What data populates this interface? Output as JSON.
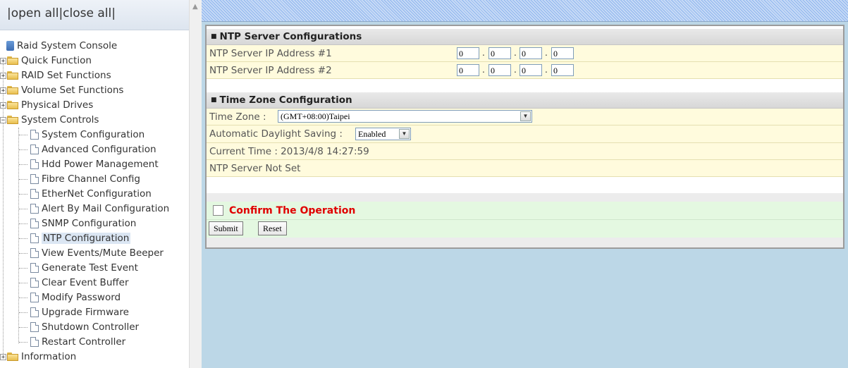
{
  "toolbar": {
    "open_all": "open all",
    "close_all": "close all",
    "separator": "|"
  },
  "tree": {
    "root_label": "Raid System Console",
    "items": [
      {
        "label": "Quick Function"
      },
      {
        "label": "RAID Set Functions"
      },
      {
        "label": "Volume Set Functions"
      },
      {
        "label": "Physical Drives"
      },
      {
        "label": "System Controls"
      },
      {
        "label": "Information"
      }
    ],
    "system_controls_children": [
      {
        "label": "System Configuration"
      },
      {
        "label": "Advanced Configuration"
      },
      {
        "label": "Hdd Power Management"
      },
      {
        "label": "Fibre Channel Config"
      },
      {
        "label": "EtherNet Configuration"
      },
      {
        "label": "Alert By Mail Configuration"
      },
      {
        "label": "SNMP Configuration"
      },
      {
        "label": "NTP Configuration"
      },
      {
        "label": "View Events/Mute Beeper"
      },
      {
        "label": "Generate Test Event"
      },
      {
        "label": "Clear Event Buffer"
      },
      {
        "label": "Modify Password"
      },
      {
        "label": "Upgrade Firmware"
      },
      {
        "label": "Shutdown Controller"
      },
      {
        "label": "Restart Controller"
      }
    ]
  },
  "form": {
    "ntp_section_title": "NTP Server Configurations",
    "ntp1_label": "NTP Server IP Address #1",
    "ntp1_octets": [
      "0",
      "0",
      "0",
      "0"
    ],
    "ntp2_label": "NTP Server IP Address #2",
    "ntp2_octets": [
      "0",
      "0",
      "0",
      "0"
    ],
    "tz_section_title": "Time Zone Configuration",
    "tz_label": "Time Zone :",
    "tz_value": "(GMT+08:00)Taipei",
    "dst_label": "Automatic Daylight Saving :",
    "dst_value": "Enabled",
    "current_time": "Current Time : 2013/4/8 14:27:59",
    "ntp_status": "NTP Server Not Set",
    "confirm_label": "Confirm The Operation",
    "submit_label": "Submit",
    "reset_label": "Reset"
  },
  "colors": {
    "accent_red": "#e00000",
    "field_row_bg": "#fffbdd",
    "confirm_bg": "#e4f8e1",
    "content_bg": "#bcd7e7"
  }
}
